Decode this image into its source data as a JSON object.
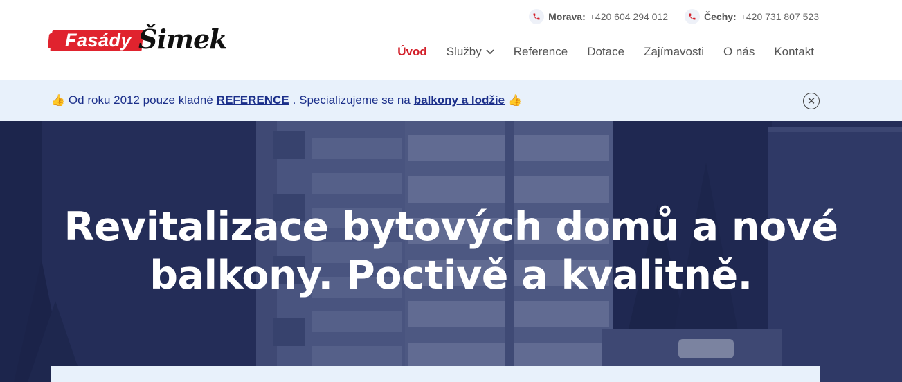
{
  "brand": {
    "name_part1": "Fasády",
    "name_part2": "Šimek"
  },
  "contacts": [
    {
      "region": "Morava:",
      "phone": "+420 604 294 012",
      "icon": "phone-icon"
    },
    {
      "region": "Čechy:",
      "phone": "+420 731 807 523",
      "icon": "phone-icon"
    }
  ],
  "nav": {
    "items": [
      {
        "label": "Úvod",
        "active": true
      },
      {
        "label": "Služby",
        "dropdown": true
      },
      {
        "label": "Reference"
      },
      {
        "label": "Dotace"
      },
      {
        "label": "Zajímavosti"
      },
      {
        "label": "O nás"
      },
      {
        "label": "Kontakt"
      }
    ]
  },
  "announcement": {
    "icon": "thumbs-up-icon",
    "text_1": "Od roku 2012 pouze kladné",
    "link_1": "REFERENCE",
    "text_2": ". Specializujeme se na",
    "link_2": "balkony a lodžie",
    "close_icon": "close-icon"
  },
  "hero": {
    "title_line1": "Revitalizace bytových domů a nové",
    "title_line2": "balkony. Poctivě a kvalitně."
  },
  "colors": {
    "accent": "#d3202a",
    "brand_red": "#e0232e",
    "link_blue": "#1b2f8a",
    "bar_bg": "#e8f1fb",
    "hero_overlay": "#26305a"
  }
}
